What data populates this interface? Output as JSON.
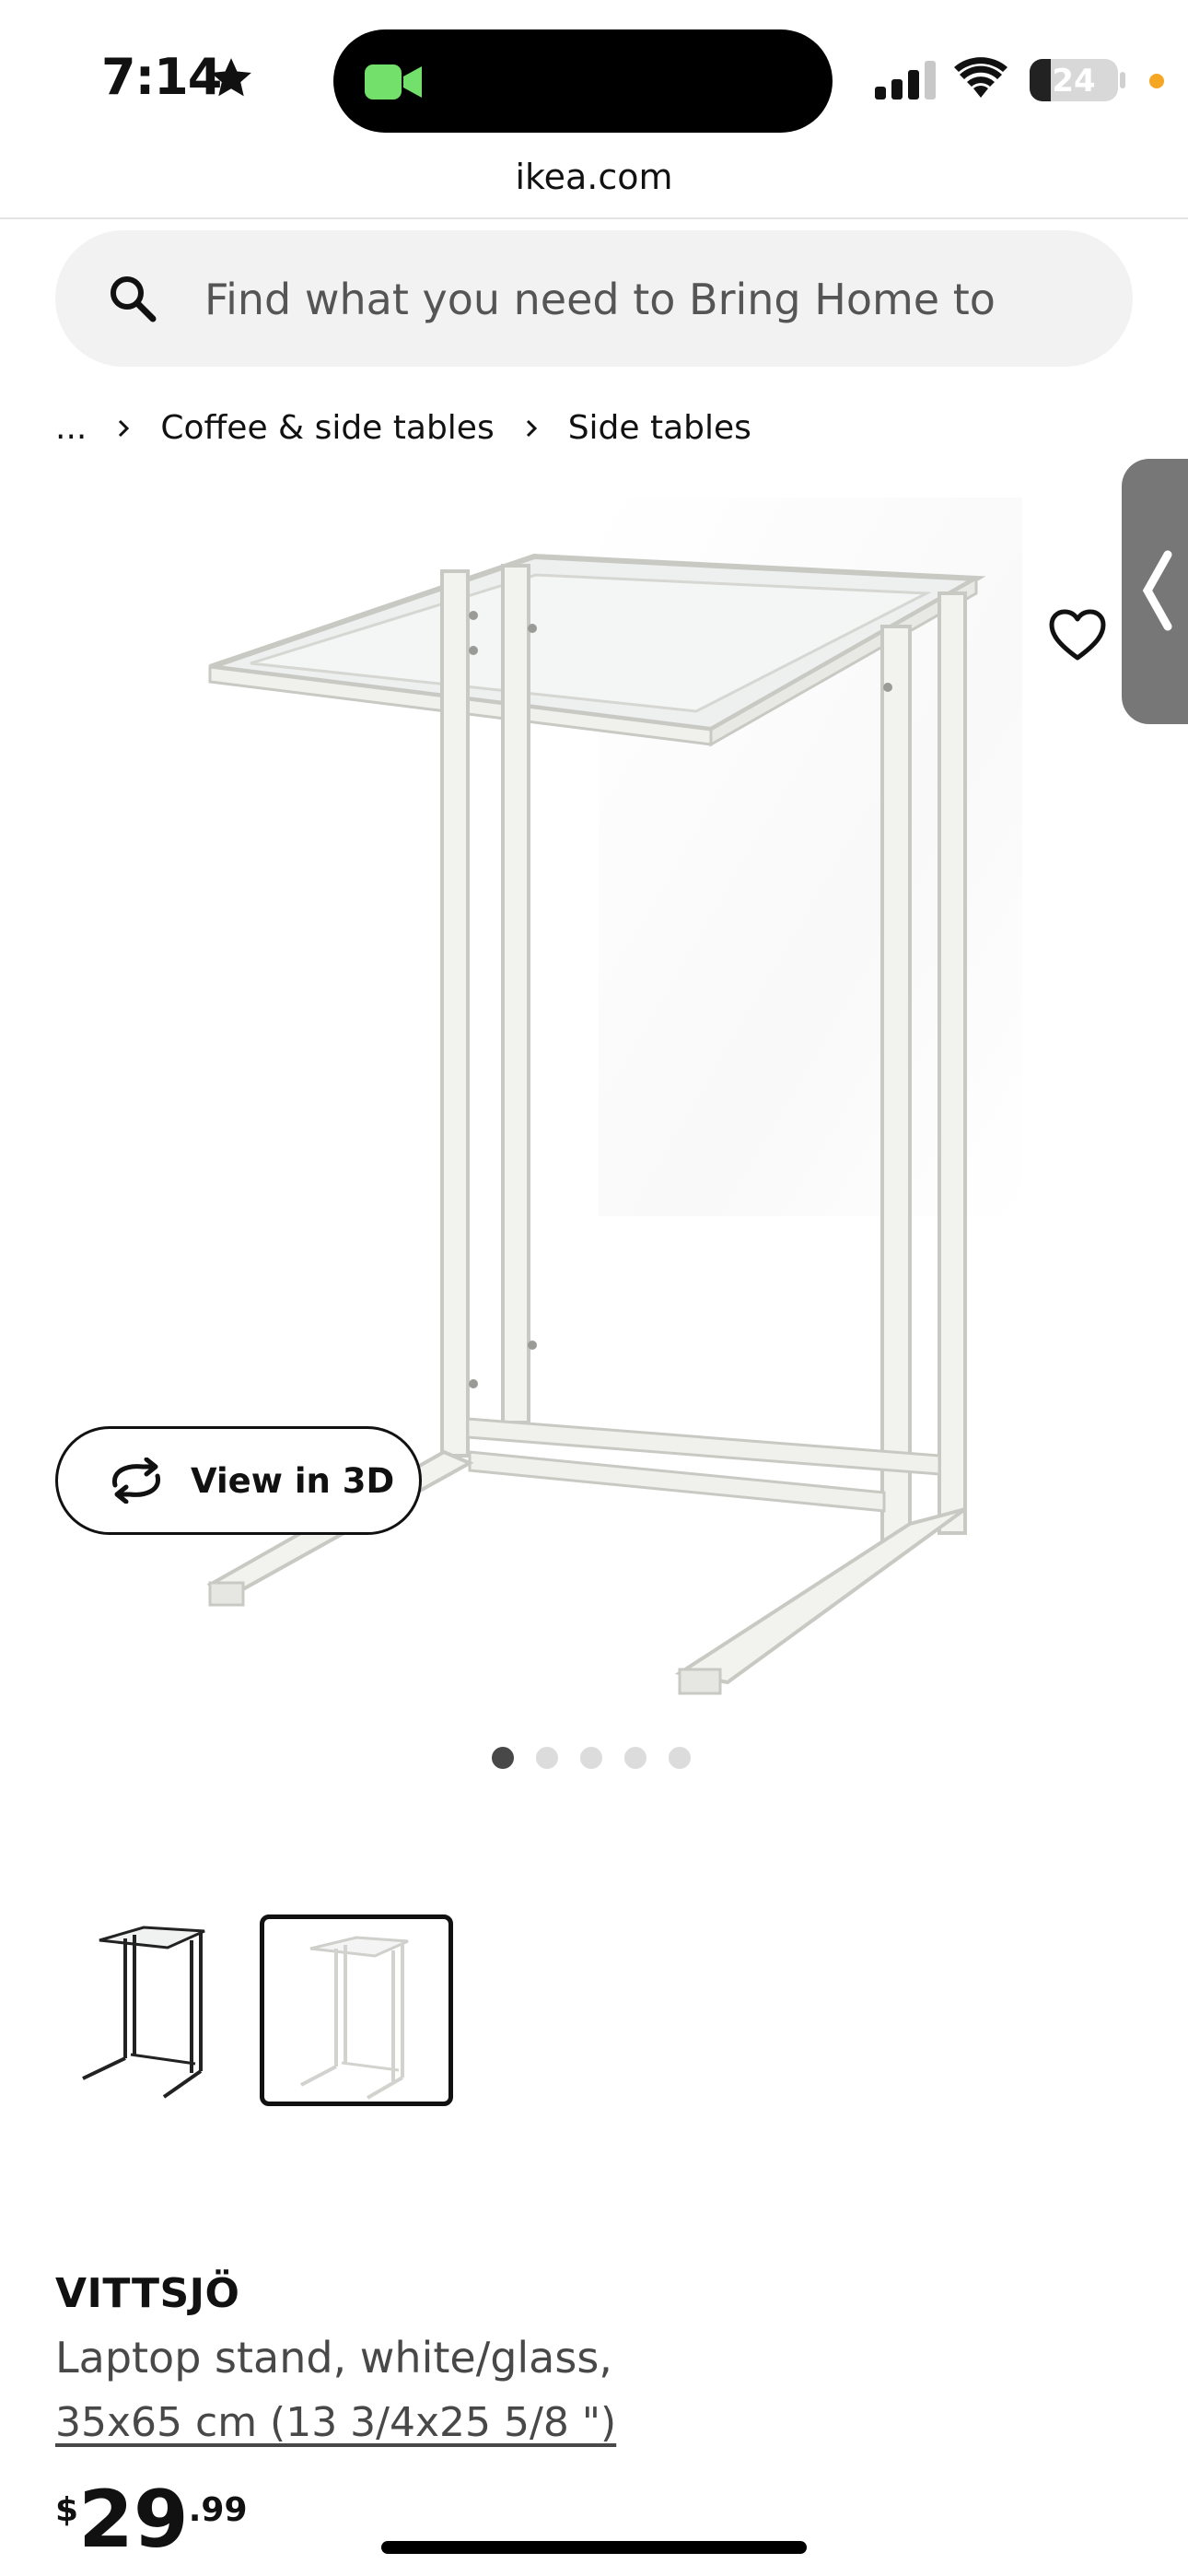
{
  "status_bar": {
    "time": "7:14",
    "battery_level": "24",
    "battery_fraction": 0.24,
    "icons": [
      "star-icon",
      "facetime-icon",
      "cellular-signal-icon",
      "wifi-icon",
      "battery-icon"
    ]
  },
  "browser": {
    "url": "ikea.com"
  },
  "search": {
    "placeholder": "Find what you need to Bring Home to"
  },
  "breadcrumb": {
    "items": [
      "...",
      "Coffee & side tables",
      "Side tables"
    ]
  },
  "gallery": {
    "view_3d_label": "View in 3D",
    "dot_count": 5,
    "active_index": 0,
    "thumbnails": [
      "black/glass",
      "white/glass"
    ],
    "selected_thumbnail": 1
  },
  "product": {
    "name": "VITTSJÖ",
    "description": "Laptop stand, white/glass,",
    "size": "35x65 cm (13 3/4x25 5/8 \")",
    "price": {
      "currency": "$",
      "whole": "29",
      "cents": ".99"
    }
  },
  "colors": {
    "accent_dot": "#f5a623",
    "facetime_green": "#72e06a",
    "search_bg": "#f2f2f2",
    "side_tab": "#777777"
  }
}
